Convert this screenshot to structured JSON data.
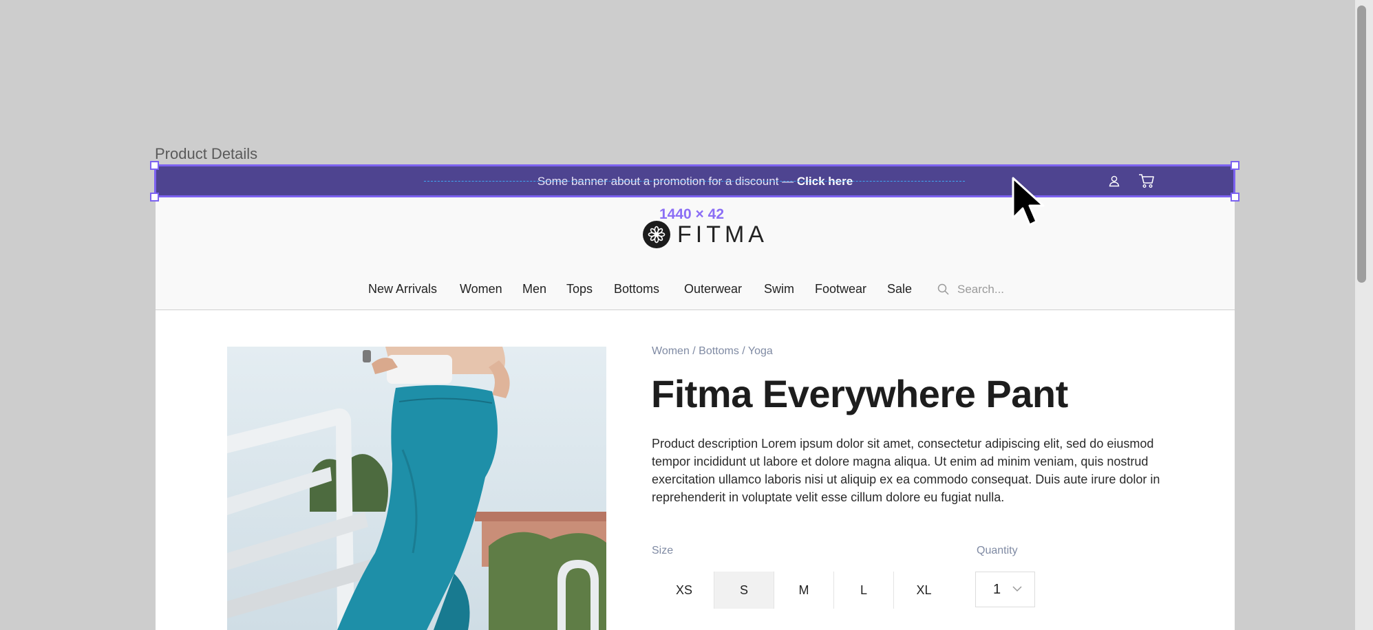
{
  "frame": {
    "label": "Product Details",
    "dimensions": "1440 × 42"
  },
  "banner": {
    "text": "Some banner about a promotion for a discount — ",
    "cta": "Click here",
    "icons": [
      "account-icon",
      "cart-icon"
    ]
  },
  "logo": {
    "text": "FITMA"
  },
  "nav": {
    "items": [
      "New Arrivals",
      "Women",
      "Men",
      "Tops",
      "Bottoms",
      "Outerwear",
      "Swim",
      "Footwear",
      "Sale"
    ]
  },
  "search": {
    "placeholder": "Search..."
  },
  "product": {
    "breadcrumb": "Women / Bottoms / Yoga",
    "title": "Fitma Everywhere Pant",
    "description": "Product description Lorem ipsum dolor sit amet, consectetur adipiscing elit, sed do eiusmod tempor incididunt ut labore et dolore magna aliqua. Ut enim ad minim veniam, quis nostrud exercitation ullamco laboris nisi ut aliquip ex ea commodo consequat. Duis aute irure dolor in reprehenderit in voluptate velit esse cillum dolore eu fugiat nulla.",
    "size_label": "Size",
    "sizes": [
      "XS",
      "S",
      "M",
      "L",
      "XL"
    ],
    "selected_size": "S",
    "quantity_label": "Quantity",
    "quantity": "1"
  },
  "colors": {
    "banner": "#4e4490",
    "selection": "#7c62f0",
    "measure": "#3fa9f5"
  }
}
